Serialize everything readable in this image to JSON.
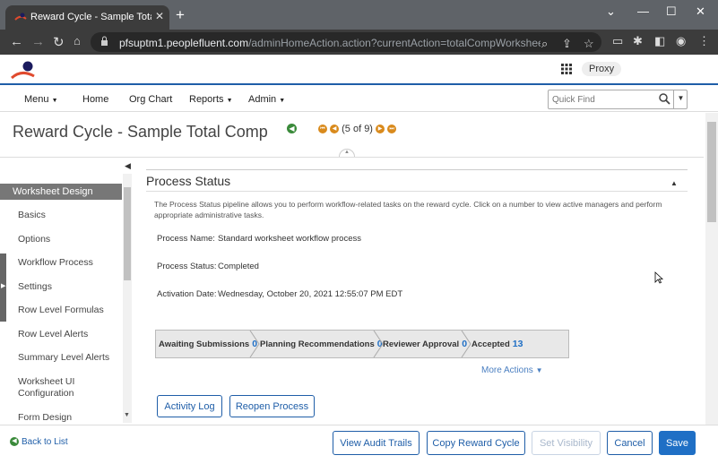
{
  "browser": {
    "tab_title": "Reward Cycle - Sample Total Com",
    "url_host": "pfsuptm1.peoplefluent.com",
    "url_path": "/adminHomeAction.action?currentAction=totalCompWorksheetRunList..."
  },
  "header": {
    "proxy_label": "Proxy"
  },
  "menu": {
    "items": [
      "Menu",
      "Home",
      "Org Chart",
      "Reports",
      "Admin"
    ],
    "quick_find_placeholder": "Quick Find"
  },
  "page": {
    "title": "Reward Cycle - Sample Total Comp",
    "pager": "(5 of 9)"
  },
  "sidebar": {
    "heading": "Worksheet Design",
    "items": [
      "Basics",
      "Options",
      "Workflow Process",
      "Settings",
      "Row Level Formulas",
      "Row Level Alerts",
      "Summary Level Alerts",
      "Worksheet UI Configuration",
      "Form Design"
    ]
  },
  "process": {
    "title": "Process Status",
    "description": "The Process Status pipeline allows you to perform workflow-related tasks on the reward cycle. Click on a number to view active managers and perform appropriate administrative tasks.",
    "name_label": "Process Name:",
    "name_value": "Standard worksheet workflow process",
    "status_label": "Process Status:",
    "status_value": "Completed",
    "activation_label": "Activation Date:",
    "activation_value": "Wednesday, October 20, 2021 12:55:07 PM EDT",
    "stages": [
      {
        "label": "Awaiting Submissions",
        "count": "0"
      },
      {
        "label": "Planning Recommendations",
        "count": "0"
      },
      {
        "label": "Reviewer Approval",
        "count": "0"
      },
      {
        "label": "Accepted",
        "count": "13"
      }
    ],
    "more_actions": "More Actions",
    "activity_log": "Activity Log",
    "reopen_process": "Reopen Process"
  },
  "footer": {
    "back_to_list": "Back to List",
    "view_audit_trails": "View Audit Trails",
    "copy_reward_cycle": "Copy Reward Cycle",
    "set_visibility": "Set Visibility",
    "cancel": "Cancel",
    "save": "Save"
  },
  "colors": {
    "brand_blue": "#1f5ea8",
    "primary": "#1f6fc5",
    "orange": "#d98a1c",
    "green": "#3a8a3a"
  }
}
